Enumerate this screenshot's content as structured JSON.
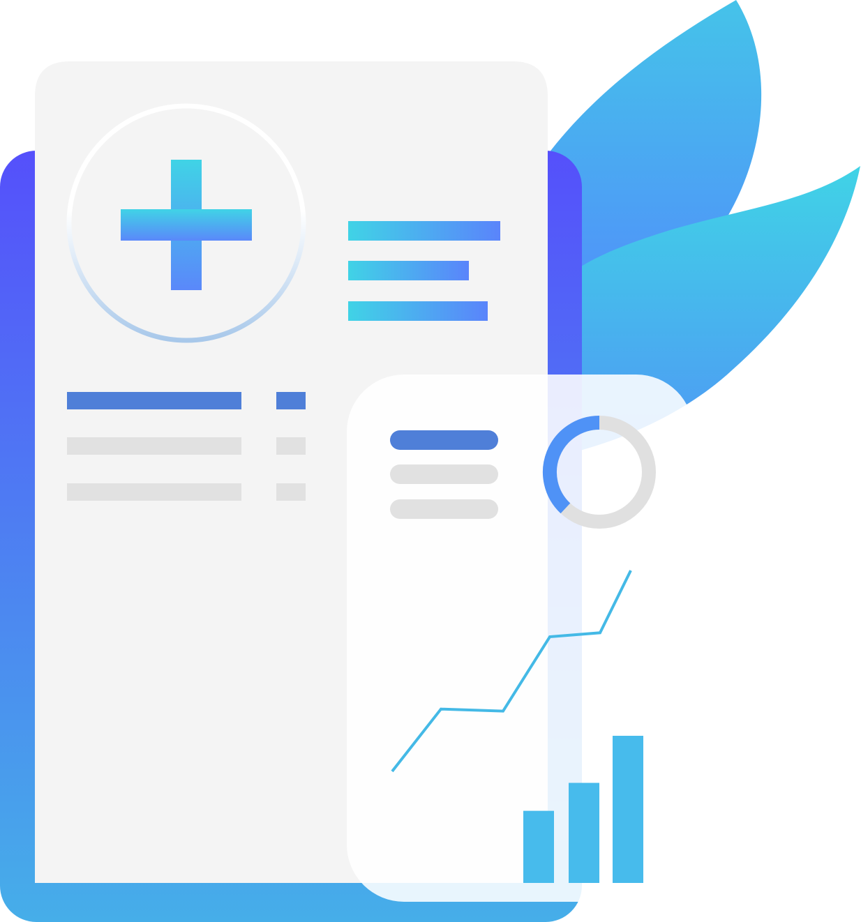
{
  "illustration": {
    "subject": "medical-report-illustration",
    "icons": {
      "header": "medical-cross-icon",
      "chart_donut": "donut-chart-icon",
      "chart_line": "line-chart-icon",
      "chart_bars": "bar-chart-icon",
      "decoration": "leaf-icon"
    },
    "colors": {
      "backing_top": "#5550fb",
      "backing_bottom": "#46aee9",
      "document": "#f4f4f4",
      "card": "#ffffff",
      "accent_dark": "#4f7fd8",
      "placeholder_gray": "#e1e1e1",
      "cyan": "#40d2e6",
      "blue": "#5a84fb",
      "leaf_top": "#45c3e9",
      "leaf_bottom": "#5090fa",
      "bar": "#47bbec",
      "line": "#44b9e6",
      "donut_track": "#e0e0e0"
    },
    "donut": {
      "filled_fraction": 0.38
    },
    "line_chart": {
      "relative_values": [
        0,
        0.31,
        0.3,
        0.67,
        0.69,
        1.0
      ]
    },
    "bar_chart": {
      "relative_values": [
        0.49,
        0.68,
        1.0
      ]
    }
  }
}
